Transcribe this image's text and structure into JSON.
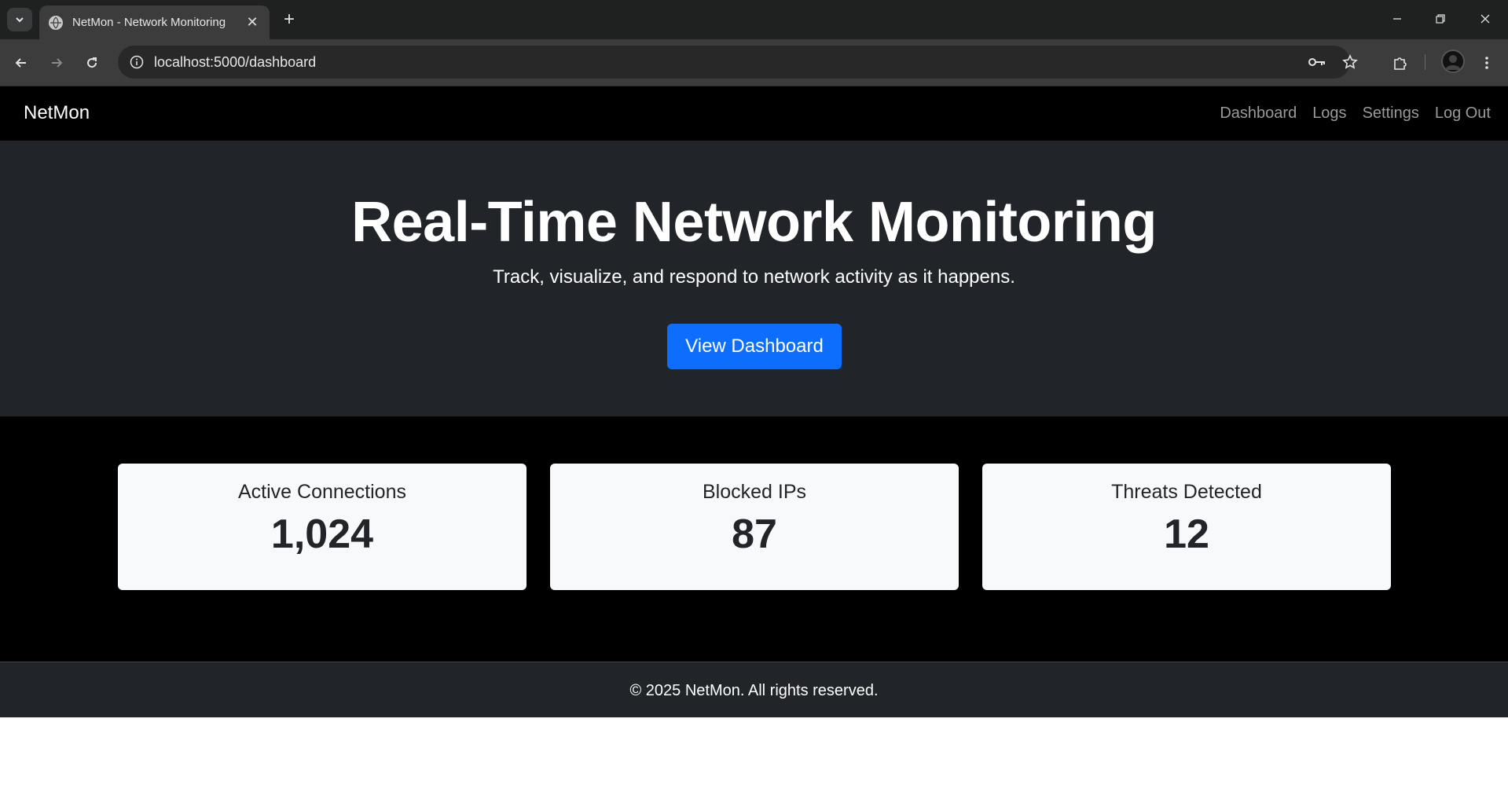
{
  "browser": {
    "tab_title": "NetMon - Network Monitoring",
    "url": "localhost:5000/dashboard"
  },
  "navbar": {
    "brand": "NetMon",
    "links": [
      "Dashboard",
      "Logs",
      "Settings",
      "Log Out"
    ]
  },
  "hero": {
    "title": "Real-Time Network Monitoring",
    "subtitle": "Track, visualize, and respond to network activity as it happens.",
    "button_label": "View Dashboard"
  },
  "stats": [
    {
      "label": "Active Connections",
      "value": "1,024"
    },
    {
      "label": "Blocked IPs",
      "value": "87"
    },
    {
      "label": "Threats Detected",
      "value": "12"
    }
  ],
  "footer": {
    "text": "© 2025 NetMon. All rights reserved."
  },
  "colors": {
    "primary_button": "#0d6efd",
    "hero_background": "#212529",
    "navbar_background": "#000000"
  }
}
